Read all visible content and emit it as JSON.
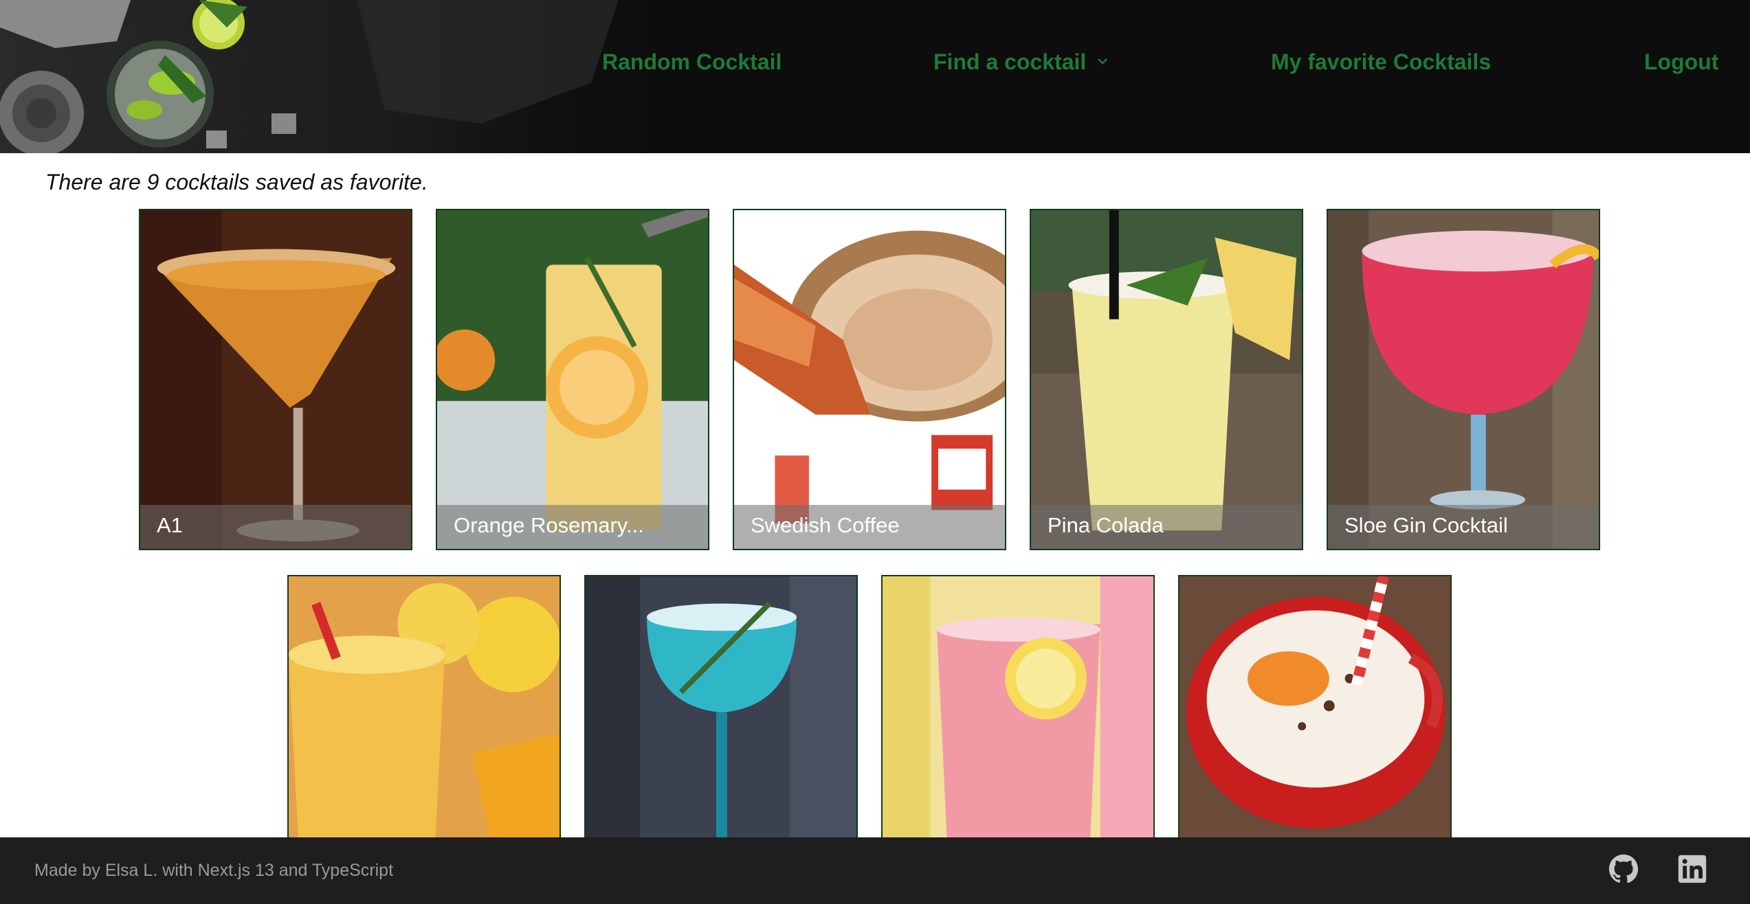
{
  "nav": {
    "random": "Random Cocktail",
    "find": "Find a cocktail",
    "favorites": "My favorite Cocktails",
    "logout": "Logout"
  },
  "main": {
    "count_text": "There are 9 cocktails saved as favorite."
  },
  "cocktails": [
    {
      "name": "A1"
    },
    {
      "name": "Orange Rosemary..."
    },
    {
      "name": "Swedish Coffee"
    },
    {
      "name": "Pina Colada"
    },
    {
      "name": "Sloe Gin Cocktail"
    },
    {
      "name": ""
    },
    {
      "name": ""
    },
    {
      "name": ""
    },
    {
      "name": ""
    }
  ],
  "footer": {
    "credit": "Made by Elsa L. with Next.js 13 and TypeScript",
    "github_icon": "github-icon",
    "linkedin_icon": "linkedin-icon"
  },
  "colors": {
    "header_bg": "#0d0d0d",
    "nav_link": "#1f7a36",
    "footer_bg": "#1e1e1e",
    "card_border": "#0f3b1d"
  }
}
